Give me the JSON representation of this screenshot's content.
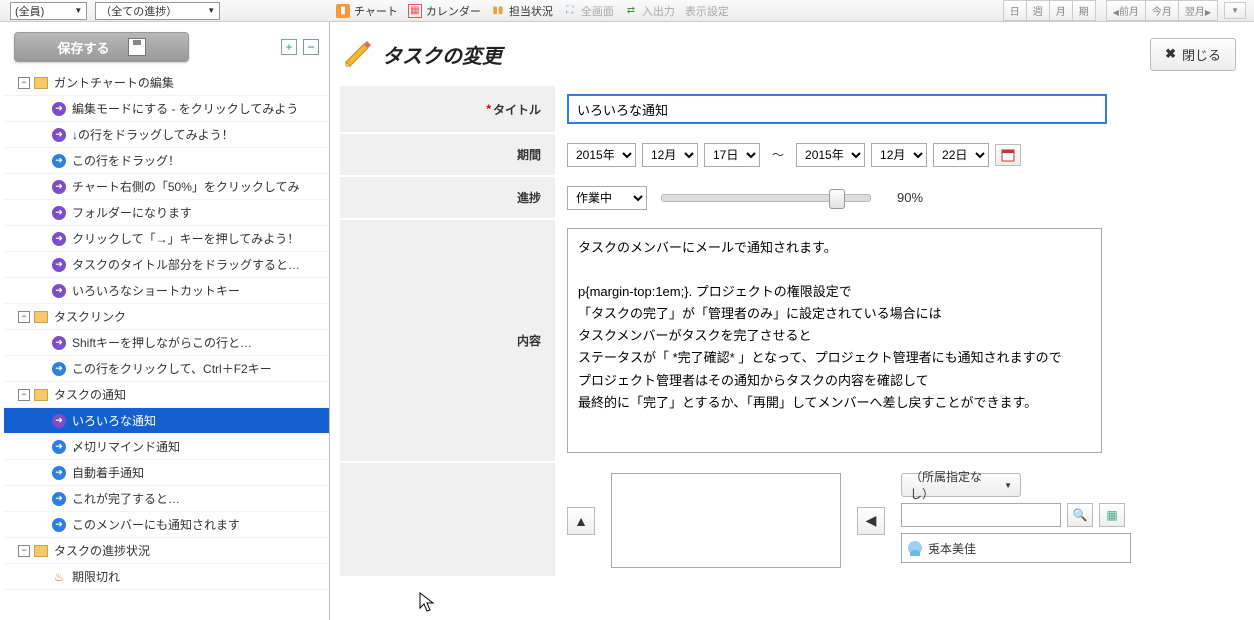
{
  "top": {
    "filter_member": "(全員)",
    "filter_progress": "（全ての進捗）",
    "toolbar": {
      "chart": "チャート",
      "calendar": "カレンダー",
      "assignment": "担当状況",
      "fullscreen": "全画面",
      "io": "入出力",
      "display": "表示設定"
    },
    "nav": {
      "day": "日",
      "week": "週",
      "month": "月",
      "period": "期",
      "prev": "前月",
      "today": "今月",
      "next": "翌月"
    }
  },
  "sidebar": {
    "save": "保存する",
    "tree": [
      {
        "type": "folder",
        "label": "ガントチャートの編集",
        "open": true,
        "children": [
          {
            "icon": "purple",
            "label": "編集モードにする - をクリックしてみよう"
          },
          {
            "icon": "purple",
            "label": "↓の行をドラッグしてみよう！"
          },
          {
            "icon": "blue",
            "label": "この行をドラッグ！"
          },
          {
            "icon": "purple",
            "label": "チャート右側の「50%」をクリックしてみ"
          },
          {
            "icon": "purple",
            "label": "フォルダーになります"
          },
          {
            "icon": "purple",
            "label": "クリックして「→」キーを押してみよう！"
          },
          {
            "icon": "purple",
            "label": "タスクのタイトル部分をドラッグすると…"
          },
          {
            "icon": "purple",
            "label": "いろいろなショートカットキー"
          }
        ]
      },
      {
        "type": "folder",
        "label": "タスクリンク",
        "open": true,
        "children": [
          {
            "icon": "purple",
            "label": "Shiftキーを押しながらこの行と…"
          },
          {
            "icon": "blue",
            "label": "この行をクリックして、Ctrl＋F2キー"
          }
        ]
      },
      {
        "type": "folder",
        "label": "タスクの通知",
        "open": true,
        "children": [
          {
            "icon": "purple",
            "label": "いろいろな通知",
            "selected": true
          },
          {
            "icon": "blue",
            "label": "〆切リマインド通知"
          },
          {
            "icon": "blue",
            "label": "自動着手通知"
          },
          {
            "icon": "blue",
            "label": "これが完了すると…"
          },
          {
            "icon": "blue",
            "label": "このメンバーにも通知されます"
          }
        ]
      },
      {
        "type": "folder",
        "label": "タスクの進捗状況",
        "open": true,
        "children": [
          {
            "icon": "fire",
            "label": "期限切れ"
          }
        ]
      }
    ]
  },
  "page": {
    "title": "タスクの変更",
    "close": "閉じる",
    "form": {
      "title_label": "タイトル",
      "title_value": "いろいろな通知",
      "period_label": "期間",
      "period": {
        "start_year": "2015年",
        "start_month": "12月",
        "start_day": "17日",
        "end_year": "2015年",
        "end_month": "12月",
        "end_day": "22日"
      },
      "progress_label": "進捗",
      "progress_status": "作業中",
      "progress_pct_value": 90,
      "progress_pct": "90%",
      "content_label": "内容",
      "content_text": "タスクのメンバーにメールで通知されます。\n\np{margin-top:1em;}. プロジェクトの権限設定で\n「タスクの完了」が「管理者のみ」に設定されている場合には\nタスクメンバーがタスクを完了させると\nステータスが「 *完了確認* 」となって、プロジェクト管理者にも通知されますので\nプロジェクト管理者はその通知からタスクの内容を確認して\n最終的に「完了」とするか、「再開」してメンバーへ差し戻すことができます。",
      "dept_select": "（所属指定なし）",
      "member_name": "兎本美佳"
    }
  }
}
